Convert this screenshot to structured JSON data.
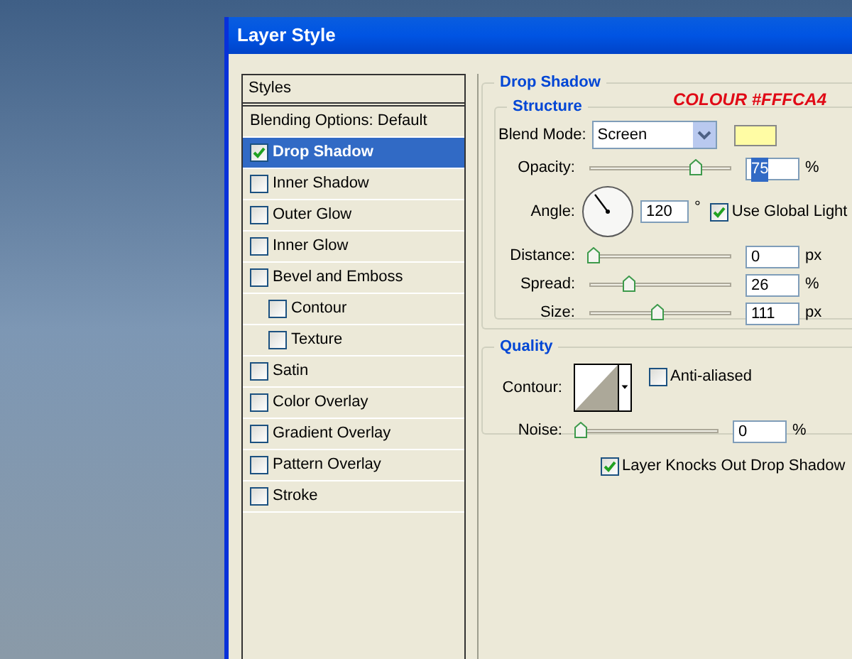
{
  "window": {
    "title": "Layer Style"
  },
  "sidebar": {
    "items": [
      {
        "kind": "header",
        "label": "Styles",
        "selected": false
      },
      {
        "kind": "option",
        "label": "Blending Options: Default",
        "selected": false
      },
      {
        "kind": "effect",
        "label": "Drop Shadow",
        "checked": true,
        "selected": true
      },
      {
        "kind": "effect",
        "label": "Inner Shadow",
        "checked": false,
        "selected": false
      },
      {
        "kind": "effect",
        "label": "Outer Glow",
        "checked": false,
        "selected": false
      },
      {
        "kind": "effect",
        "label": "Inner Glow",
        "checked": false,
        "selected": false
      },
      {
        "kind": "effect",
        "label": "Bevel and Emboss",
        "checked": false,
        "selected": false,
        "children": [
          {
            "kind": "effect",
            "label": "Contour",
            "checked": false,
            "selected": false
          },
          {
            "kind": "effect",
            "label": "Texture",
            "checked": false,
            "selected": false
          }
        ]
      },
      {
        "kind": "effect",
        "label": "Satin",
        "checked": false,
        "selected": false
      },
      {
        "kind": "effect",
        "label": "Color Overlay",
        "checked": false,
        "selected": false
      },
      {
        "kind": "effect",
        "label": "Gradient Overlay",
        "checked": false,
        "selected": false
      },
      {
        "kind": "effect",
        "label": "Pattern Overlay",
        "checked": false,
        "selected": false
      },
      {
        "kind": "effect",
        "label": "Stroke",
        "checked": false,
        "selected": false
      }
    ]
  },
  "panel": {
    "title": "Drop Shadow",
    "annotation": "COLOUR #FFFCA4",
    "structure": {
      "title": "Structure",
      "rows": [
        {
          "kind": "select",
          "label": "Blend Mode:",
          "value": "Screen",
          "color": "#fffca4"
        },
        {
          "kind": "slider",
          "label": "Opacity:",
          "level": 0.77,
          "value": "75",
          "unit": "%",
          "highlighted": true
        },
        {
          "kind": "angle",
          "label": "Angle:",
          "value": "120",
          "unit": "°",
          "checkbox": {
            "label": "Use Global Light",
            "checked": true
          }
        },
        {
          "kind": "slider",
          "label": "Distance:",
          "level": 0,
          "value": "0",
          "unit": "px",
          "highlighted": false
        },
        {
          "kind": "slider",
          "label": "Spread:",
          "level": 0.27,
          "value": "26",
          "unit": "%",
          "highlighted": false
        },
        {
          "kind": "slider",
          "label": "Size:",
          "level": 0.48,
          "value": "111",
          "unit": "px",
          "highlighted": false
        }
      ]
    },
    "quality": {
      "title": "Quality",
      "rows": [
        {
          "kind": "contour",
          "label": "Contour:",
          "checkbox": {
            "label": "Anti-aliased",
            "checked": false
          }
        },
        {
          "kind": "slider",
          "label": "Noise:",
          "level": 0,
          "value": "0",
          "unit": "%",
          "highlighted": false
        }
      ]
    },
    "knockout": {
      "label": "Layer Knocks Out Drop Shadow",
      "checked": true
    }
  }
}
